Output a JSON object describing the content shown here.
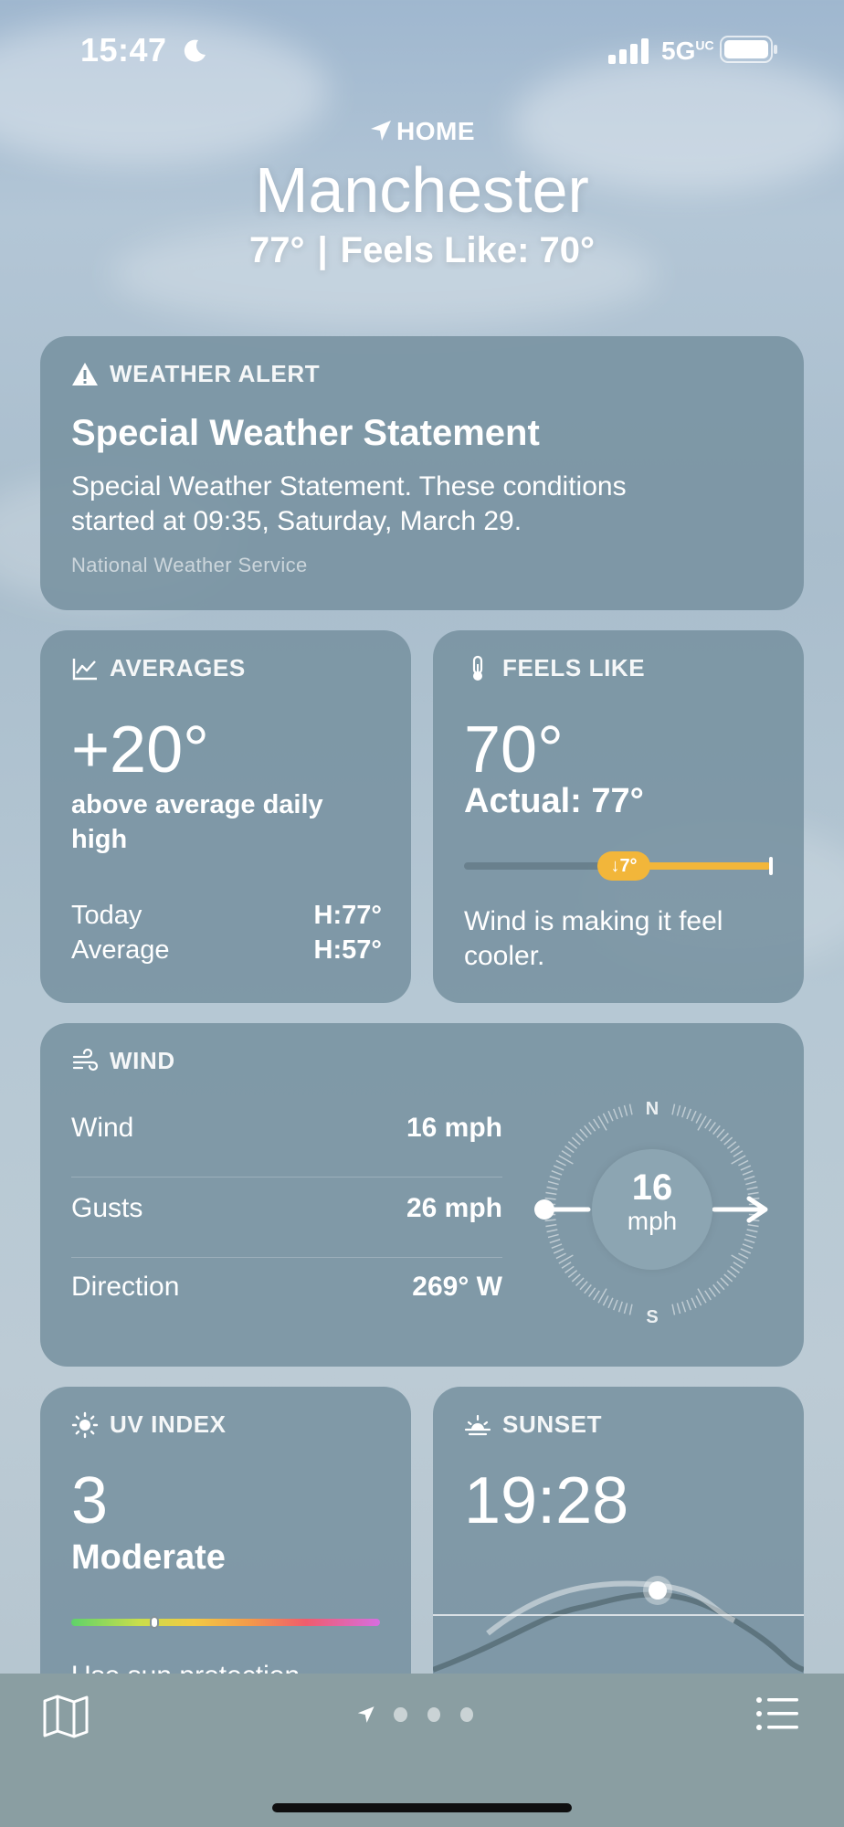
{
  "status_bar": {
    "time": "15:47",
    "network": "5G",
    "network_sup": "UC"
  },
  "header": {
    "location_label": "HOME",
    "city": "Manchester",
    "temperature": "77°",
    "separator": "|",
    "feels_like": "Feels Like: 70°"
  },
  "alert_card": {
    "heading": "WEATHER ALERT",
    "title": "Special Weather Statement",
    "body": "Special Weather Statement. These conditions started at 09:35, Saturday, March 29.",
    "source": "National Weather Service"
  },
  "averages_card": {
    "heading": "AVERAGES",
    "value": "+20°",
    "description": "above average daily high",
    "rows": [
      {
        "label": "Today",
        "value": "H:77°"
      },
      {
        "label": "Average",
        "value": "H:57°"
      }
    ]
  },
  "feels_like_card": {
    "heading": "FEELS LIKE",
    "value": "70°",
    "actual": "Actual: 77°",
    "difference": "↓7°",
    "description": "Wind is making it feel cooler."
  },
  "wind_card": {
    "heading": "WIND",
    "rows": [
      {
        "label": "Wind",
        "value": "16 mph"
      },
      {
        "label": "Gusts",
        "value": "26 mph"
      },
      {
        "label": "Direction",
        "value": "269° W"
      }
    ],
    "compass": {
      "north": "N",
      "south": "S",
      "speed": "16",
      "unit": "mph",
      "direction_degrees": 269
    }
  },
  "uv_card": {
    "heading": "UV INDEX",
    "value": "3",
    "level": "Moderate",
    "level_fraction": 0.27,
    "tip": "Use sun protection"
  },
  "sunset_card": {
    "heading": "SUNSET",
    "time": "19:28"
  },
  "bottom_bar": {
    "pages": 3,
    "active_page": 0
  },
  "colors": {
    "card_bg": "#7892a0",
    "feels_like_accent": "#f2b63a",
    "bottom_bar": "#8a9ea2"
  },
  "icons": {
    "location": "location-arrow-icon",
    "alert": "warning-triangle-icon",
    "averages": "chart-trend-icon",
    "feels_like": "thermometer-icon",
    "wind": "wind-icon",
    "uv": "sun-icon",
    "sunset": "sunset-icon",
    "map": "map-icon",
    "list": "list-icon"
  }
}
